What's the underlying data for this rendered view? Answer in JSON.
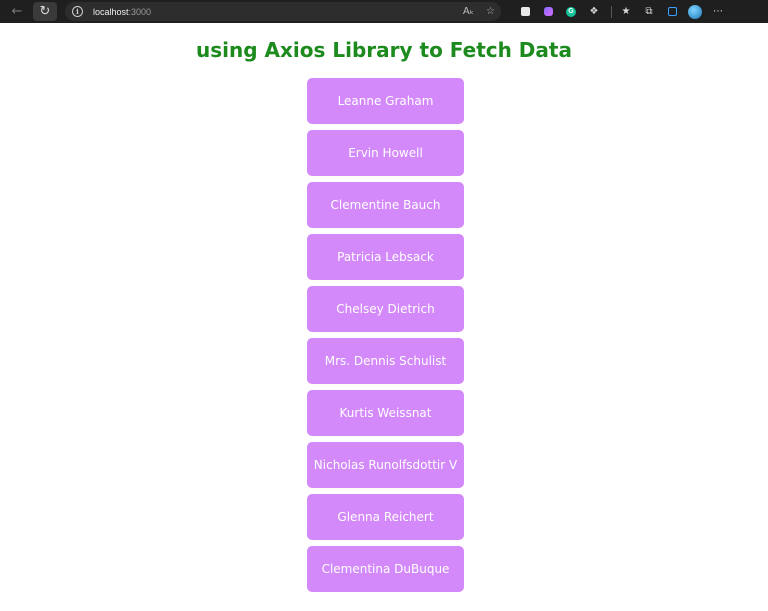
{
  "browser": {
    "address_host": "localhost",
    "address_port": ":3000",
    "read_aloud_icon": "read-aloud-icon",
    "favorite_icon": "add-favorite-icon"
  },
  "page": {
    "title": "using Axios Library to Fetch Data",
    "title_color": "#1c8a1c",
    "button_color": "#d389f9",
    "users": [
      "Leanne Graham",
      "Ervin Howell",
      "Clementine Bauch",
      "Patricia Lebsack",
      "Chelsey Dietrich",
      "Mrs. Dennis Schulist",
      "Kurtis Weissnat",
      "Nicholas Runolfsdottir V",
      "Glenna Reichert",
      "Clementina DuBuque"
    ]
  }
}
